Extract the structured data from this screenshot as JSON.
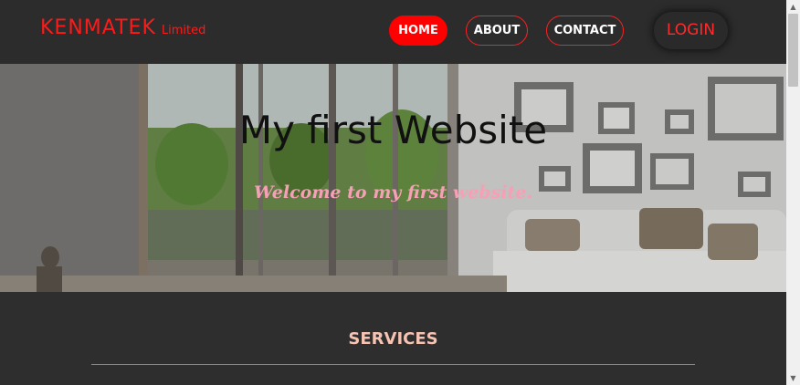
{
  "header": {
    "brand_name": "KENMATEK",
    "brand_sub": "Limited",
    "nav": [
      "HOME",
      "ABOUT",
      "CONTACT"
    ],
    "login": "LOGIN"
  },
  "hero": {
    "title": "My first Website",
    "subtitle": "Welcome to my first website."
  },
  "services": {
    "title": "SERVICES"
  },
  "colors": {
    "accent": "#ff0000",
    "header_bg": "#2c2c2c",
    "page_bg": "#2e2e2e",
    "subtitle": "#f6a0b6",
    "services_title": "#f6c3b3"
  },
  "icons": {
    "scroll_up": "triangle-up-icon",
    "scroll_down": "triangle-down-icon"
  }
}
